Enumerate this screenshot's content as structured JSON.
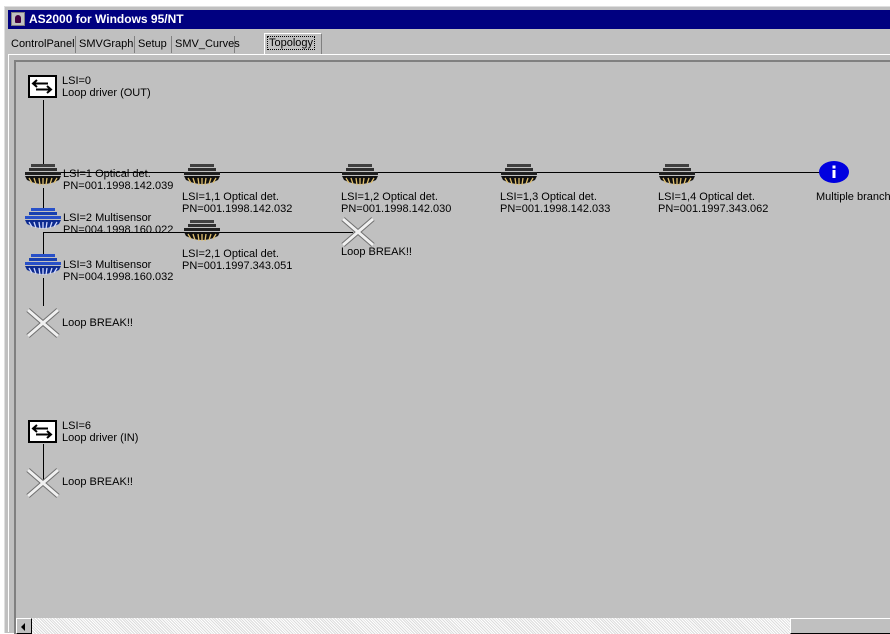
{
  "window": {
    "title": "AS2000 for Windows 95/NT"
  },
  "tabs": [
    {
      "label": "ControlPanel"
    },
    {
      "label": "SMVGraph"
    },
    {
      "label": "Setup"
    },
    {
      "label": "SMV_Curves"
    },
    {
      "label": "Topology",
      "active": true
    }
  ],
  "topology": {
    "driver_out": {
      "line1": "LSI=0",
      "line2": "Loop driver (OUT)"
    },
    "dev1": {
      "line1": "LSI=1 Optical det.",
      "line2": "PN=001.1998.142.039",
      "icon": "optical-detector"
    },
    "dev2": {
      "line1": "LSI=2 Multisensor",
      "line2": "PN=004.1998.160.022",
      "icon": "multisensor"
    },
    "dev3": {
      "line1": "LSI=3 Multisensor",
      "line2": "PN=004.1998.160.032",
      "icon": "multisensor"
    },
    "break_main": {
      "label": "Loop BREAK!!"
    },
    "b11": {
      "line1": "LSI=1,1 Optical det.",
      "line2": "PN=001.1998.142.032"
    },
    "b12": {
      "line1": "LSI=1,2 Optical det.",
      "line2": "PN=001.1998.142.030"
    },
    "b13": {
      "line1": "LSI=1,3 Optical det.",
      "line2": "PN=001.1998.142.033"
    },
    "b14": {
      "line1": "LSI=1,4 Optical det.",
      "line2": "PN=001.1997.343.062"
    },
    "multi": {
      "label": "Multiple branch"
    },
    "b21": {
      "line1": "LSI=2,1 Optical det.",
      "line2": "PN=001.1997.343.051"
    },
    "break_b2": {
      "label": "Loop BREAK!!"
    },
    "driver_in": {
      "line1": "LSI=6",
      "line2": "Loop driver (IN)"
    },
    "break_in": {
      "label": "Loop BREAK!!"
    }
  },
  "colors": {
    "titlebar": "#000080",
    "multisensor": "#2850c8",
    "info": "#0000e0",
    "face": "#c0c0c0"
  }
}
